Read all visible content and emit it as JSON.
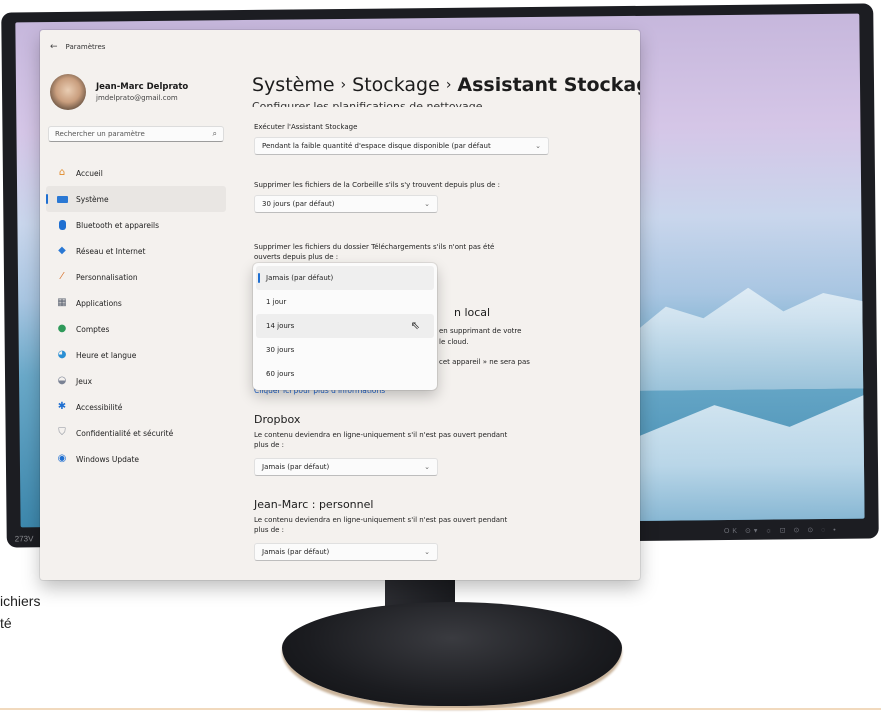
{
  "monitor": {
    "brand_label": "273V",
    "buttons_text": "OK   ⊙▾   ☼  ⊡   ⊙ ⊙   ◌      •"
  },
  "side_text": [
    "ichiers",
    "té"
  ],
  "window": {
    "app_title": "Paramètres",
    "profile": {
      "name": "Jean-Marc Delprato",
      "email": "jmdelprato@gmail.com"
    },
    "search": {
      "placeholder": "Rechercher un paramètre"
    },
    "nav": [
      {
        "label": "Accueil",
        "icon": "home-icon"
      },
      {
        "label": "Système",
        "icon": "display-icon"
      },
      {
        "label": "Bluetooth et appareils",
        "icon": "bluetooth-icon"
      },
      {
        "label": "Réseau et Internet",
        "icon": "wifi-icon"
      },
      {
        "label": "Personnalisation",
        "icon": "brush-icon"
      },
      {
        "label": "Applications",
        "icon": "apps-icon"
      },
      {
        "label": "Comptes",
        "icon": "person-icon"
      },
      {
        "label": "Heure et langue",
        "icon": "globe-clock-icon"
      },
      {
        "label": "Jeux",
        "icon": "gamepad-icon"
      },
      {
        "label": "Accessibilité",
        "icon": "accessibility-icon"
      },
      {
        "label": "Confidentialité et sécurité",
        "icon": "shield-icon"
      },
      {
        "label": "Windows Update",
        "icon": "update-icon"
      }
    ],
    "active_nav": "Système",
    "breadcrumb": [
      "Système",
      "Stockage",
      "Assistant Stockage"
    ],
    "cut_heading": "Configurer les planifications de nettoyage",
    "run_label": "Exécuter l'Assistant Stockage",
    "run_value": "Pendant la faible quantité d'espace disque disponible (par défaut",
    "recycle_label": "Supprimer les fichiers de la Corbeille s'ils s'y trouvent depuis plus de :",
    "recycle_value": "30 jours (par défaut)",
    "downloads_label_1": "Supprimer les fichiers du dossier Téléchargements s'ils n'ont pas été",
    "downloads_label_2": "ouverts depuis plus de :",
    "downloads_menu": {
      "options": [
        "Jamais (par défaut)",
        "1 jour",
        "14 jours",
        "30 jours",
        "60 jours"
      ],
      "selected": "Jamais (par défaut)",
      "hovered": "14 jours"
    },
    "hidden_section": {
      "title_fragment": "n local",
      "line1": "en supprimant de votre",
      "line2": "le cloud.",
      "line3": "cet appareil » ne sera pas"
    },
    "info_link": "Cliquer ici pour plus d'informations",
    "dropbox": {
      "title": "Dropbox",
      "desc_1": "Le contenu deviendra en ligne-uniquement s'il n'est pas ouvert pendant",
      "desc_2": "plus de :",
      "value": "Jamais (par défaut)"
    },
    "personal": {
      "title": "Jean-Marc : personnel",
      "desc_1": "Le contenu deviendra en ligne-uniquement s'il n'est pas ouvert pendant",
      "desc_2": "plus de :",
      "value": "Jamais (par défaut)"
    }
  },
  "colors": {
    "accent": "#1f6fd1",
    "link": "#1b5fc9",
    "window_bg": "#f4f1ee"
  }
}
